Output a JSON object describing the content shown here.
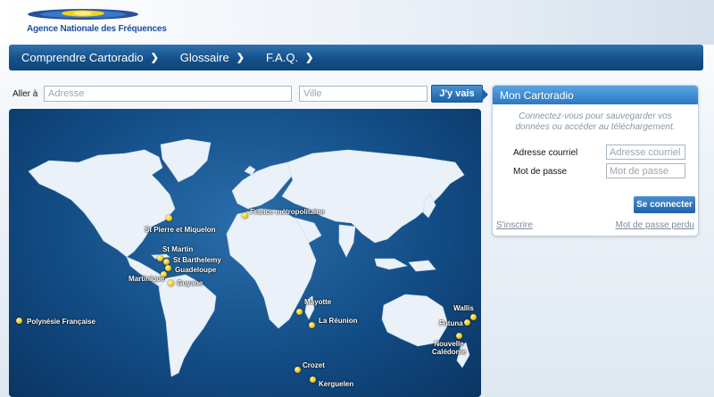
{
  "header": {
    "org_name": "Agence Nationale des Fréquences"
  },
  "nav": {
    "items": [
      {
        "label": "Comprendre Cartoradio"
      },
      {
        "label": "Glossaire"
      },
      {
        "label": "F.A.Q."
      }
    ]
  },
  "search": {
    "goto_label": "Aller à",
    "address_placeholder": "Adresse",
    "city_placeholder": "Ville",
    "go_label": "J'y vais"
  },
  "map": {
    "territories": [
      {
        "name": "France métropolitaine"
      },
      {
        "name": "St Pierre et Miquelon"
      },
      {
        "name": "St Martin"
      },
      {
        "name": "St Barthelemy"
      },
      {
        "name": "Guadeloupe"
      },
      {
        "name": "Martinique"
      },
      {
        "name": "Guyane"
      },
      {
        "name": "Polynésie Française"
      },
      {
        "name": "Mayotte"
      },
      {
        "name": "La Réunion"
      },
      {
        "name": "Crozet"
      },
      {
        "name": "Kerguelen"
      },
      {
        "name": "Wallis"
      },
      {
        "name": "Futuna"
      },
      {
        "name": "Nouvelle Calédonie"
      }
    ]
  },
  "login": {
    "title": "Mon Cartoradio",
    "info": "Connectez-vous pour sauvegarder vos données ou accéder au téléchargement.",
    "email_label": "Adresse courriel",
    "email_placeholder": "Adresse courriel",
    "password_label": "Mot de passe",
    "password_placeholder": "Mot de passe",
    "submit_label": "Se connecter",
    "register_link": "S'inscrire",
    "forgot_link": "Mot de passe perdu"
  },
  "colors": {
    "nav_blue": "#14508a",
    "ocean_blue": "#134d86",
    "marker_yellow": "#f0c419",
    "panel_header": "#2c79c2"
  }
}
